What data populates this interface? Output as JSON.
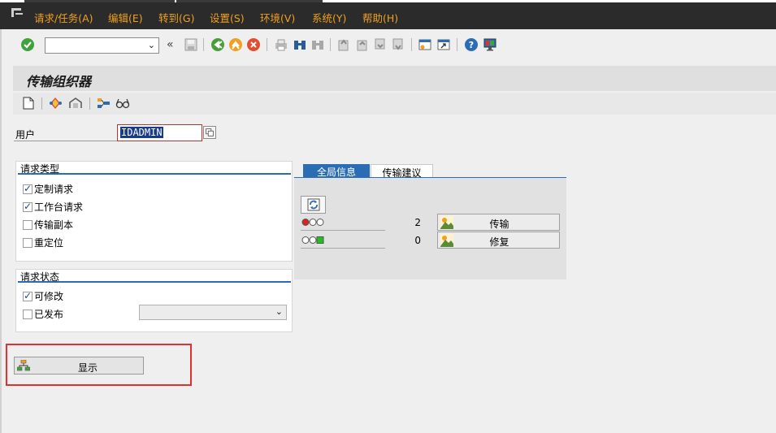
{
  "menu": {
    "items": [
      "请求/任务(A)",
      "编辑(E)",
      "转到(G)",
      "设置(S)",
      "环境(V)",
      "系统(Y)",
      "帮助(H)"
    ]
  },
  "toolbar": {
    "command_value": ""
  },
  "page": {
    "title": "传输组织器"
  },
  "user": {
    "label": "用户",
    "value": "IDADMIN"
  },
  "request_type": {
    "title": "请求类型",
    "options": [
      {
        "label": "定制请求",
        "checked": true
      },
      {
        "label": "工作台请求",
        "checked": true
      },
      {
        "label": "传输副本",
        "checked": false
      },
      {
        "label": "重定位",
        "checked": false
      }
    ]
  },
  "request_status": {
    "title": "请求状态",
    "options": [
      {
        "label": "可修改",
        "checked": true
      },
      {
        "label": "已发布",
        "checked": false
      }
    ],
    "date_value": ""
  },
  "tabs": {
    "items": [
      "全局信息",
      "传输建议"
    ],
    "active": 0
  },
  "global_info": {
    "rows": [
      {
        "count": "2",
        "button": "传输"
      },
      {
        "count": "0",
        "button": "修复"
      }
    ]
  },
  "display_button": {
    "label": "显示"
  },
  "colors": {
    "menubar": "#2b2b2b",
    "menu_text": "#f0a020",
    "accent_blue": "#2a6db5",
    "highlight_red": "#e03030"
  }
}
